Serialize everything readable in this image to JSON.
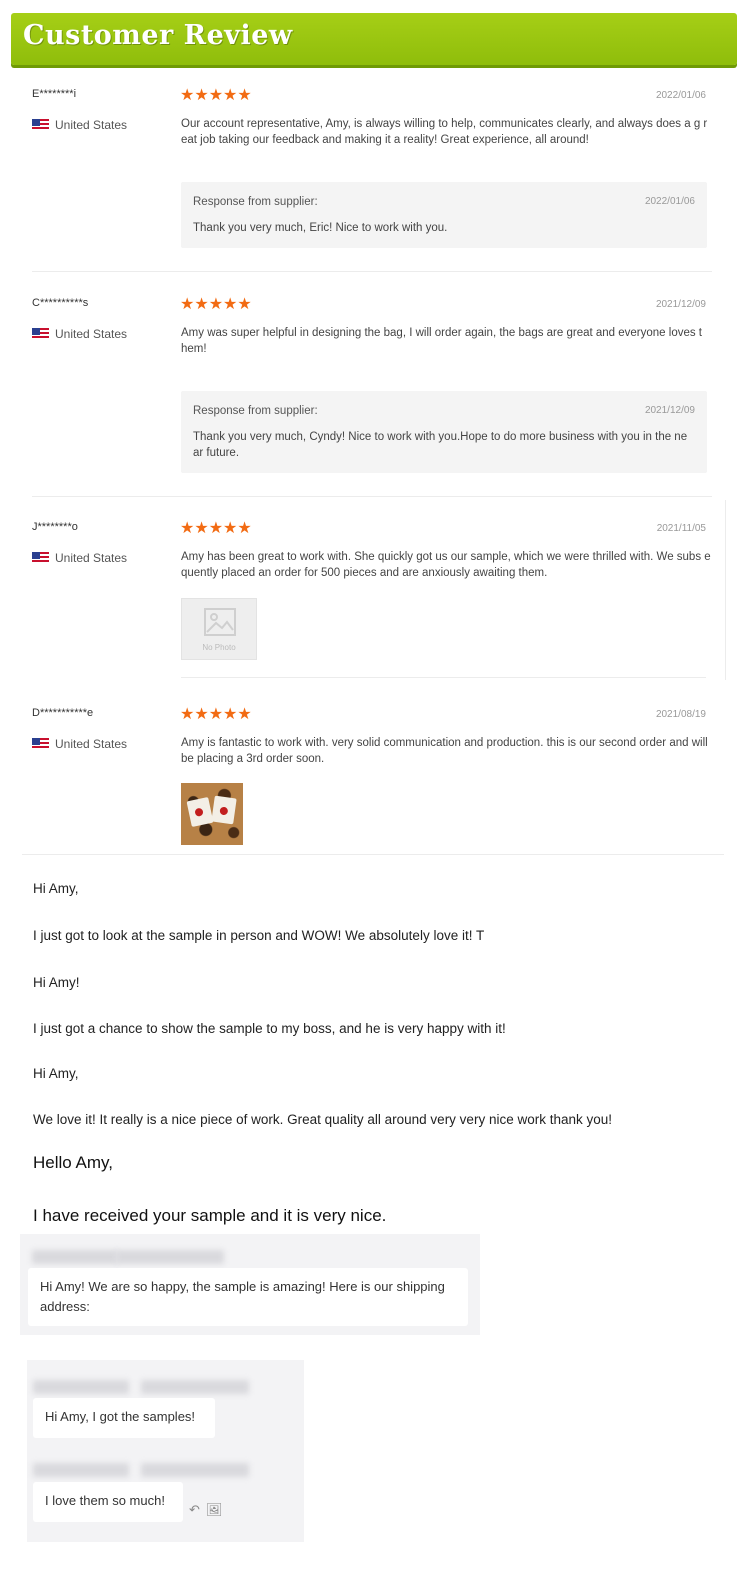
{
  "banner": {
    "title": "Customer Review"
  },
  "reviews": [
    {
      "name": "E********i",
      "country": "United States",
      "stars": "★★★★★",
      "date": "2022/01/06",
      "text": "Our account representative, Amy, is always willing to help, communicates clearly, and always does a g reat job taking our feedback and making it a reality! Great experience, all around!",
      "response": {
        "label": "Response from supplier:",
        "date": "2022/01/06",
        "text": "Thank you very much, Eric! Nice to work with you."
      }
    },
    {
      "name": "C**********s",
      "country": "United States",
      "stars": "★★★★★",
      "date": "2021/12/09",
      "text": "Amy was super helpful in designing the bag, I will order again, the bags are great and everyone loves t hem!",
      "response": {
        "label": "Response from supplier:",
        "date": "2021/12/09",
        "text": "Thank you very much, Cyndy! Nice to work with you.Hope to do more business with you in the ne ar future."
      }
    },
    {
      "name": "J********o",
      "country": "United States",
      "stars": "★★★★★",
      "date": "2021/11/05",
      "text": "Amy has been great to work with. She quickly got us our sample, which we were thrilled with. We subs equently placed an order for 500 pieces and are anxiously awaiting them.",
      "photo_label": "No Photo"
    },
    {
      "name": "D***********e",
      "country": "United States",
      "stars": "★★★★★",
      "date": "2021/08/19",
      "text": "Amy is fantastic to work with. very solid communication and production. this is our second order and will be placing a 3rd order soon."
    }
  ],
  "messages": [
    "Hi Amy,",
    "I just got to look at the sample in person and WOW! We absolutely love it! T",
    "Hi Amy!",
    "I just got a chance to show the sample to my boss, and he is very happy with it!",
    "Hi Amy,",
    "We love it! It really is a nice piece of work.  Great quality all around very very nice work thank you!",
    "Hello Amy,",
    "I have received your sample and it is very nice."
  ],
  "chats": [
    "Hi Amy! We are so happy, the sample is amazing! Here is our shipping address:",
    "Hi Amy, I got the samples!",
    "I love them so much!"
  ],
  "colors": {
    "banner": "#9cc812",
    "stars": "#f26b13"
  },
  "icons": [
    "us-flag-icon",
    "star-icon",
    "no-photo-icon",
    "reply-icon",
    "image-icon"
  ]
}
